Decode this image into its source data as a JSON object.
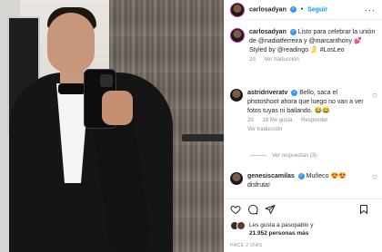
{
  "header": {
    "username": "carlosadyan",
    "follow_label": "Seguir",
    "more_icon": "more-dots-icon"
  },
  "caption": {
    "username": "carlosadyan",
    "text": "Listo para celebrar la unión de @nadiatferreira y @marcanthony 💕 Styled by @readingo 🎗️ #LosLeo",
    "time": "2d",
    "translate": "Ver traducción"
  },
  "comments": [
    {
      "username": "astridriveratv",
      "text": "Bello, saca el photoshoot ahora que luego no van a ver fotos tuyas ni bailando. 😂😂",
      "time": "2d",
      "likes": "18 Me gusta",
      "reply": "Responder",
      "translate": "Ver traducción"
    },
    {
      "username": "genesiscamilas",
      "text": "Muñeco 😍😍 disfruta!"
    }
  ],
  "replies_label": "Ver respuestas (3)",
  "likes": {
    "line1": "Les gusta a pasopablo y",
    "line2": "21.952 personas más"
  },
  "timestamp": "HACE 2 DÍAS",
  "colors": {
    "accent": "#0095f6",
    "verified": "#3897f0",
    "muted": "#8e8e8e"
  }
}
